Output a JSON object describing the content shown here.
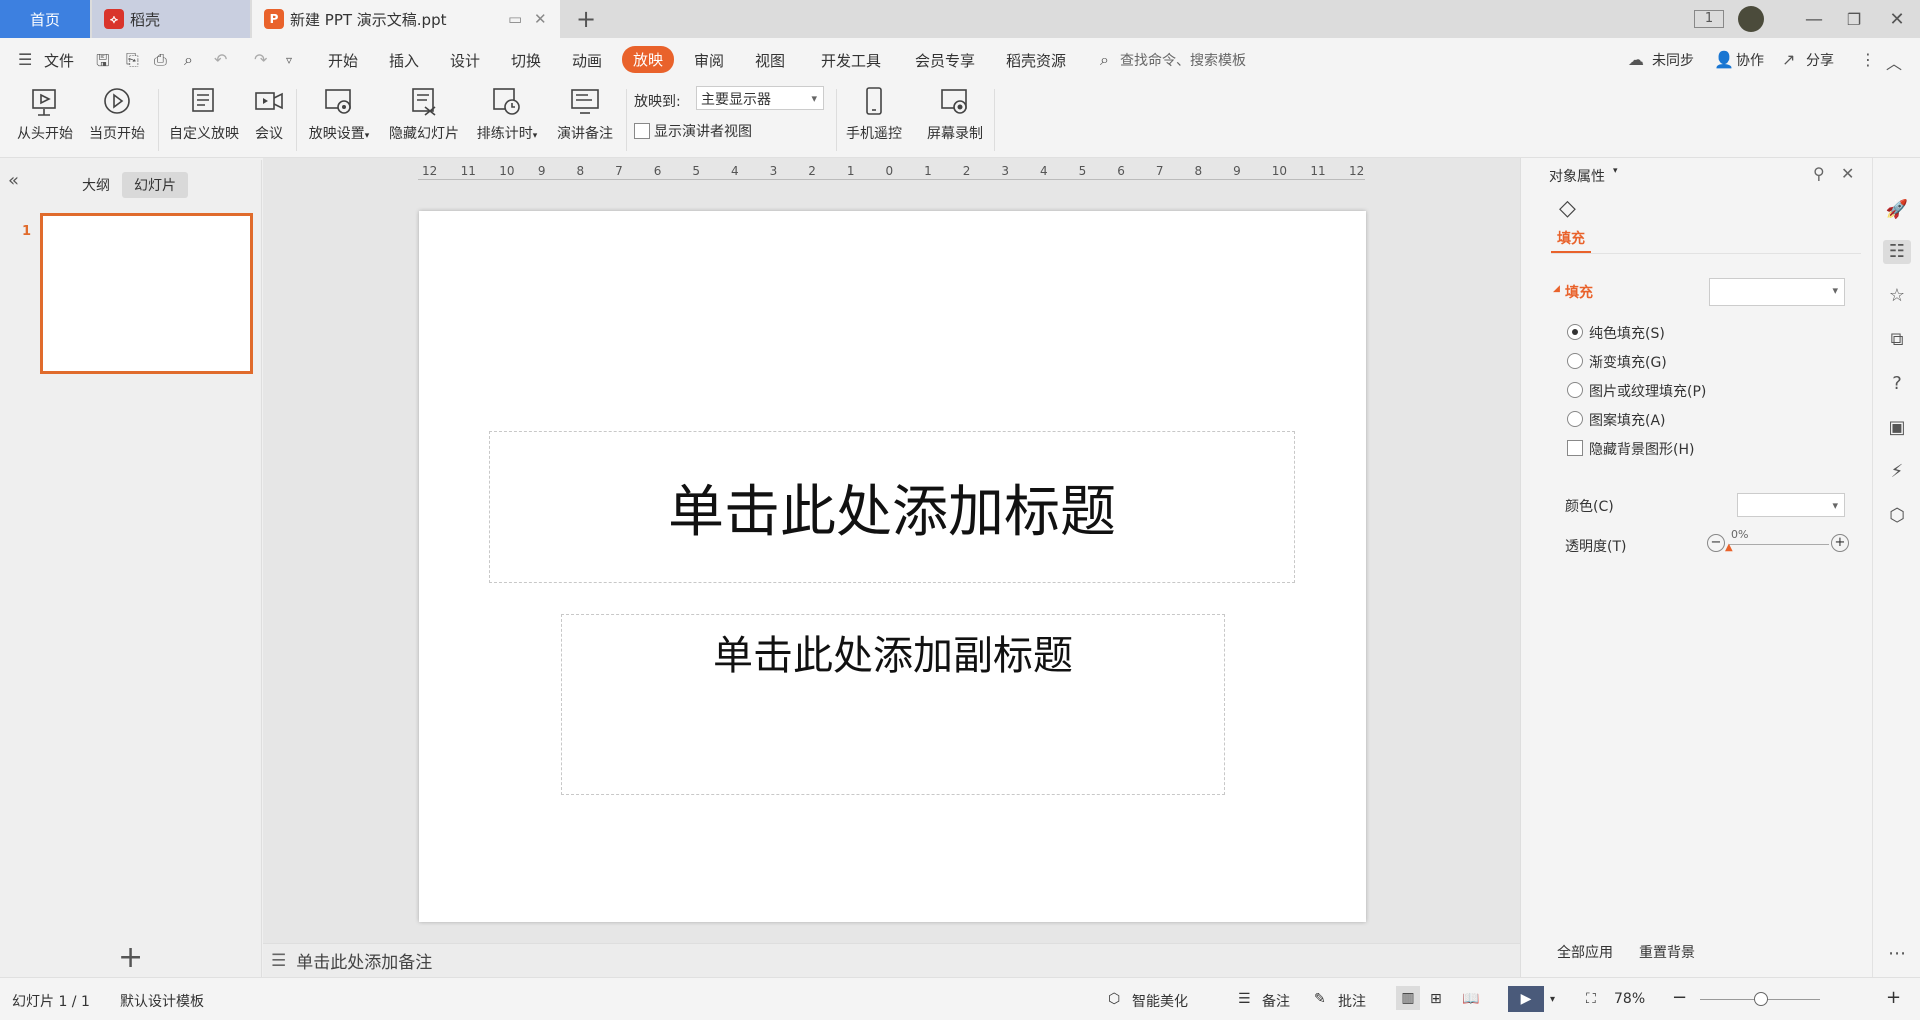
{
  "tabs": {
    "home": "首页",
    "daoke": "稻壳",
    "doc": "新建 PPT 演示文稿.ppt",
    "add": "+"
  },
  "menu": {
    "file": "文件",
    "items": [
      "开始",
      "插入",
      "设计",
      "切换",
      "动画",
      "放映",
      "审阅",
      "视图",
      "开发工具",
      "会员专享",
      "稻壳资源"
    ],
    "active": "放映",
    "search": "查找命令、搜索模板",
    "sync": "未同步",
    "collab": "协作",
    "share": "分享"
  },
  "ribbon": {
    "from_start": "从头开始",
    "from_current": "当页开始",
    "custom_show": "自定义放映",
    "meeting": "会议",
    "show_settings": "放映设置",
    "hide_slide": "隐藏幻灯片",
    "rehearse": "排练计时",
    "speaker_notes": "演讲备注",
    "show_to_label": "放映到:",
    "show_to_value": "主要显示器",
    "presenter_view": "显示演讲者视图",
    "phone_remote": "手机遥控",
    "screen_record": "屏幕录制"
  },
  "left_panel": {
    "tab_outline": "大纲",
    "tab_slides": "幻灯片",
    "slide_number": "1",
    "add": "+"
  },
  "ruler": [
    "12",
    "11",
    "10",
    "9",
    "8",
    "7",
    "6",
    "5",
    "4",
    "3",
    "2",
    "1",
    "0",
    "1",
    "2",
    "3",
    "4",
    "5",
    "6",
    "7",
    "8",
    "9",
    "10",
    "11",
    "12"
  ],
  "slide": {
    "title_placeholder": "单击此处添加标题",
    "subtitle_placeholder": "单击此处添加副标题"
  },
  "notes_placeholder": "单击此处添加备注",
  "right_panel": {
    "header": "对象属性",
    "tab_fill": "填充",
    "section_fill": "填充",
    "opt_solid": "纯色填充(S)",
    "opt_gradient": "渐变填充(G)",
    "opt_picture": "图片或纹理填充(P)",
    "opt_pattern": "图案填充(A)",
    "opt_hide_bg": "隐藏背景图形(H)",
    "color_label": "颜色(C)",
    "transparency_label": "透明度(T)",
    "transparency_value": "0%",
    "apply_all": "全部应用",
    "reset_bg": "重置背景"
  },
  "status": {
    "slide_count": "幻灯片 1 / 1",
    "template": "默认设计模板",
    "beautify": "智能美化",
    "notes": "备注",
    "comments": "批注",
    "zoom": "78%"
  },
  "colors": {
    "accent": "#e9622b",
    "home_tab": "#3d80e0"
  }
}
